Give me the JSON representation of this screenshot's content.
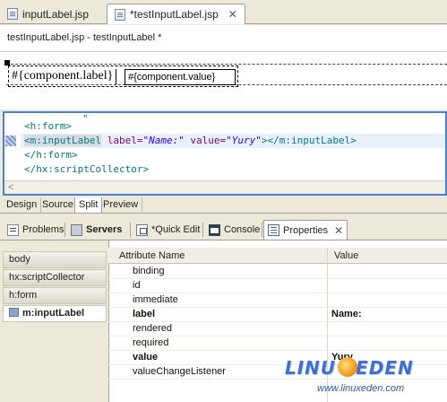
{
  "editor_tabs": [
    {
      "label": "inputLabel.jsp",
      "active": false
    },
    {
      "label": "*testInputLabel.jsp",
      "active": true
    }
  ],
  "breadcrumb": "testInputLabel.jsp - testInputLabel *",
  "design": {
    "label_expr": "#{component.label}",
    "value_expr": "#{component.value}"
  },
  "source": {
    "line0": "\"",
    "lines": [
      {
        "text": "<h:form>"
      },
      {
        "tag_open": "<m:inputLabel",
        "attr1": " label=",
        "val1": "\"Name:\"",
        "attr2": " value=",
        "val2": "\"Yury\"",
        "tag_close": "></m:inputLabel>"
      },
      {
        "text": "</h:form>"
      },
      {
        "text": "</hx:scriptCollector>"
      }
    ],
    "scroll_arrow": "<"
  },
  "view_tabs": [
    "Design",
    "Source",
    "Split",
    "Preview"
  ],
  "selected_view": "Split",
  "bottom_tabs": [
    {
      "label": "Problems",
      "icon": "problems-icon"
    },
    {
      "label": "Servers",
      "icon": "servers-icon"
    },
    {
      "label": "*Quick Edit",
      "icon": "quick-edit-icon"
    },
    {
      "label": "Console",
      "icon": "console-icon"
    },
    {
      "label": "Properties",
      "icon": "properties-icon",
      "active": true
    }
  ],
  "close_glyph": "✕",
  "tag_tree": [
    "body",
    "hx:scriptCollector",
    "h:form",
    "m:inputLabel"
  ],
  "table": {
    "headers": [
      "Attribute Name",
      "Value"
    ],
    "rows": [
      {
        "name": "binding",
        "value": "",
        "bold": false
      },
      {
        "name": "id",
        "value": "",
        "bold": false
      },
      {
        "name": "immediate",
        "value": "",
        "bold": false
      },
      {
        "name": "label",
        "value": "Name:",
        "bold": true
      },
      {
        "name": "rendered",
        "value": "",
        "bold": false
      },
      {
        "name": "required",
        "value": "",
        "bold": false
      },
      {
        "name": "value",
        "value": "Yury",
        "bold": true
      },
      {
        "name": "valueChangeListener",
        "value": "",
        "bold": false
      }
    ]
  },
  "watermark": {
    "brand_left": "LINU",
    "brand_right": "EDEN",
    "url": "www.linuxeden.com"
  },
  "colors": {
    "accent": "#4a7fd8",
    "tag": "#007c7c",
    "attr": "#7f007f",
    "string": "#2a00ff"
  }
}
